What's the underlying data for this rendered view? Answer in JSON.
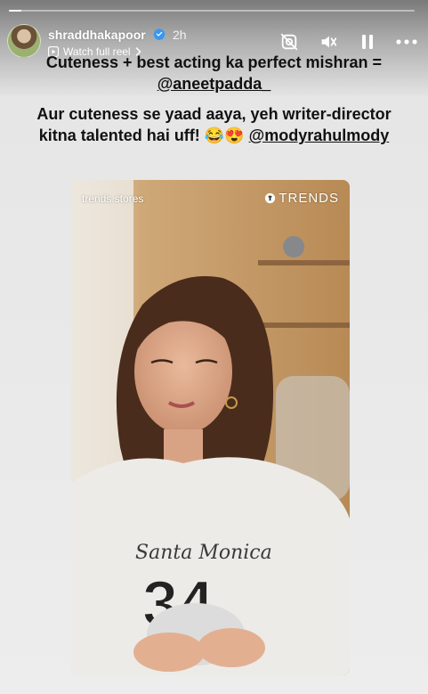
{
  "story": {
    "username": "shraddhakapoor",
    "time_ago": "2h",
    "watch_label": "Watch full reel",
    "progress": 0.03
  },
  "caption": {
    "line1_text": "Cuteness + best acting ka perfect mishran =",
    "line1_mention": "@aneetpadda_",
    "line2_text": "Aur cuteness se yaad aaya, yeh writer-director kitna talented hai uff! 😂😍",
    "line2_mention": "@modyrahulmody"
  },
  "video": {
    "watermark_left": "trends.stores",
    "watermark_right": "TRENDS",
    "shirt_text": "Santa Monica",
    "shirt_number": "34"
  },
  "icons": {
    "verified": "verified-badge-icon",
    "watch": "reel-play-icon",
    "camera_off": "camera-off-icon",
    "mute": "speaker-muted-icon",
    "pause": "pause-icon",
    "more": "more-options-icon",
    "brand_logo": "trends-logo-icon"
  },
  "colors": {
    "verified_blue": "#3897f0",
    "caption_text": "#111111",
    "header_text": "#ffffff"
  }
}
